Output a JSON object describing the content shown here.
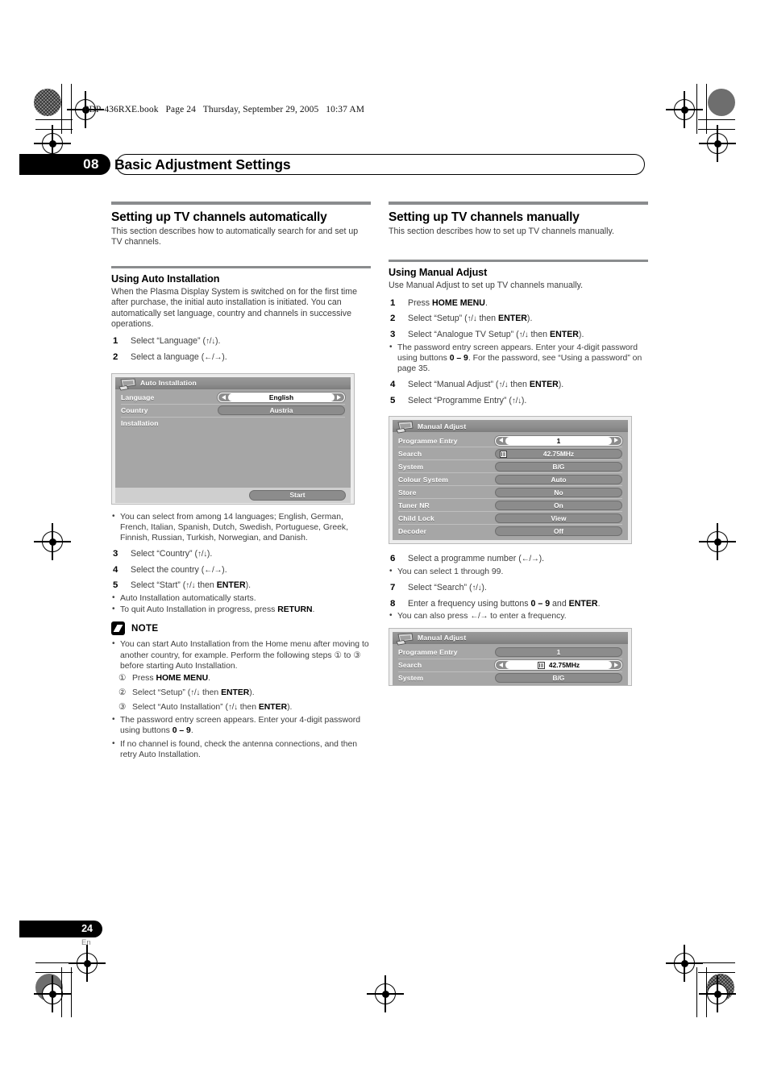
{
  "file_strip": {
    "filename": "PDP-436RXE.book",
    "page": "Page 24",
    "date": "Thursday, September 29, 2005",
    "time": "10:37 AM"
  },
  "header": {
    "chapter_number": "08",
    "chapter_title": "Basic Adjustment Settings"
  },
  "footer": {
    "page_number": "24",
    "language_code": "En"
  },
  "left_column": {
    "section_title": "Setting up TV channels automatically",
    "section_lede": "This section describes how to automatically search for and set up TV channels.",
    "subsection_title": "Using Auto Installation",
    "subsection_body": "When the Plasma Display System is switched on for the first time after purchase, the initial auto installation is initiated. You can automatically set language, country and channels in successive operations.",
    "steps_1_2": [
      {
        "num": "1",
        "text_html": "Select “Language” (<span class=\"arrows\">↑/↓</span>)."
      },
      {
        "num": "2",
        "text_html": "Select a language (<span class=\"arrows\">←/→</span>)."
      }
    ],
    "language_note": "You can select from among 14 languages; English, German, French, Italian, Spanish, Dutch, Swedish, Portuguese, Greek, Finnish, Russian, Turkish, Norwegian, and Danish.",
    "steps_3_5": [
      {
        "num": "3",
        "text_html": "Select “Country” (<span class=\"arrows\">↑/↓</span>)."
      },
      {
        "num": "4",
        "text_html": "Select the country (<span class=\"arrows\">←/→</span>)."
      },
      {
        "num": "5",
        "text_html": "Select “Start” (<span class=\"arrows\">↑/↓</span> then <b>ENTER</b>)."
      }
    ],
    "step5_bullets_html": [
      "Auto Installation automatically starts.",
      "To quit Auto Installation in progress, press <b>RETURN</b>."
    ],
    "note": {
      "label": "NOTE",
      "bullet1_html": "You can start Auto Installation from the Home menu after moving to another country, for example. Perform the following steps ① to ③ before starting Auto Installation.",
      "circled_steps": [
        {
          "mark": "①",
          "text_html": "Press <b>HOME MENU</b>."
        },
        {
          "mark": "②",
          "text_html": "Select “Setup” (<span class=\"arrows\">↑/↓</span> then <b>ENTER</b>)."
        },
        {
          "mark": "③",
          "text_html": "Select “Auto Installation” (<span class=\"arrows\">↑/↓</span> then <b>ENTER</b>)."
        }
      ],
      "circled_sub_bullet_html": "The password entry screen appears. Enter your 4-digit password using buttons <b>0 – 9</b>.",
      "bullet2_html": "If no channel is found, check the antenna connections, and then retry Auto Installation."
    },
    "osd_auto_install": {
      "title": "Auto Installation",
      "rows": [
        {
          "label": "Language",
          "value": "English",
          "style": "selected-arrows"
        },
        {
          "label": "Country",
          "value": "Austria",
          "style": "plain"
        },
        {
          "label": "Installation",
          "value": "",
          "style": "label-only"
        }
      ],
      "footer_button": "Start"
    }
  },
  "right_column": {
    "section_title": "Setting up TV channels manually",
    "section_lede": "This section describes how to set up TV channels manually.",
    "subsection_title": "Using Manual Adjust",
    "subsection_body": "Use Manual Adjust to set up TV channels manually.",
    "steps_1_3": [
      {
        "num": "1",
        "text_html": "Press <b>HOME MENU</b>."
      },
      {
        "num": "2",
        "text_html": "Select “Setup” (<span class=\"arrows\">↑/↓</span> then <b>ENTER</b>)."
      },
      {
        "num": "3",
        "text_html": "Select “Analogue TV Setup” (<span class=\"arrows\">↑/↓</span> then <b>ENTER</b>)."
      }
    ],
    "step3_bullet_html": "The password entry screen appears. Enter your 4-digit password using buttons <b>0 – 9</b>. For the password, see “Using a password” on page 35.",
    "steps_4_5": [
      {
        "num": "4",
        "text_html": "Select “Manual Adjust” (<span class=\"arrows\">↑/↓</span> then <b>ENTER</b>)."
      },
      {
        "num": "5",
        "text_html": "Select “Programme Entry” (<span class=\"arrows\">↑/↓</span>)."
      }
    ],
    "steps_6_8": [
      {
        "num": "6",
        "text_html": "Select a programme number (<span class=\"arrows\">←/→</span>)."
      },
      {
        "num": "7",
        "text_html": "Select “Search” (<span class=\"arrows\">↑/↓</span>)."
      },
      {
        "num": "8",
        "text_html": "Enter a frequency using buttons <b>0 – 9</b> and <b>ENTER</b>."
      }
    ],
    "step6_bullet_html": "You can select 1 through 99.",
    "step8_bullet_html": "You can also press <span class=\"arrows\">←/→</span> to enter a frequency.",
    "osd_manual_adjust_1": {
      "title": "Manual Adjust",
      "rows": [
        {
          "label": "Programme Entry",
          "value": "1",
          "style": "selected-arrows"
        },
        {
          "label": "Search",
          "value": "42.75MHz",
          "style": "freq"
        },
        {
          "label": "System",
          "value": "B/G",
          "style": "plain"
        },
        {
          "label": "Colour System",
          "value": "Auto",
          "style": "plain"
        },
        {
          "label": "Store",
          "value": "No",
          "style": "plain"
        },
        {
          "label": "Tuner NR",
          "value": "On",
          "style": "plain"
        },
        {
          "label": "Child Lock",
          "value": "View",
          "style": "plain"
        },
        {
          "label": "Decoder",
          "value": "Off",
          "style": "plain"
        }
      ]
    },
    "osd_manual_adjust_2": {
      "title": "Manual Adjust",
      "rows": [
        {
          "label": "Programme Entry",
          "value": "1",
          "style": "plain"
        },
        {
          "label": "Search",
          "value": "42.75MHz",
          "style": "freq-selected"
        },
        {
          "label": "System",
          "value": "B/G",
          "style": "plain"
        }
      ]
    }
  }
}
